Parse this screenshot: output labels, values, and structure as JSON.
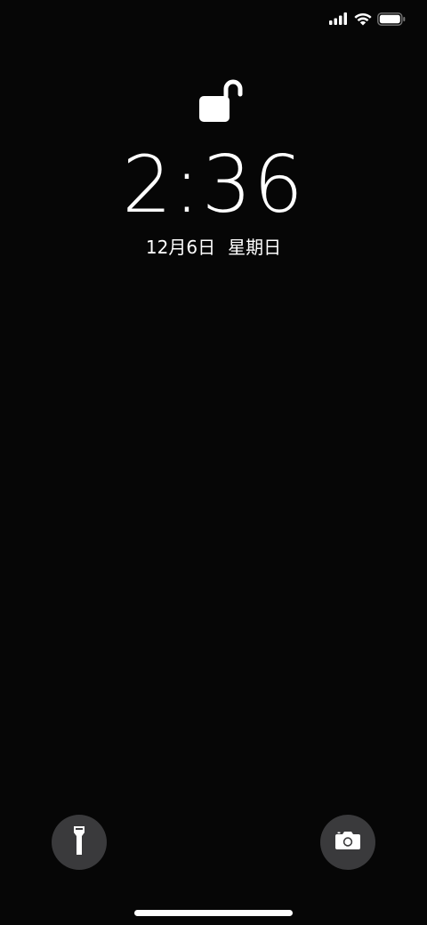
{
  "status_bar": {
    "signal_icon": "cellular-signal-icon",
    "wifi_icon": "wifi-icon",
    "battery_icon": "battery-icon",
    "battery_level": 1.0
  },
  "lock_screen": {
    "lock_icon": "unlocked-padlock-icon",
    "time": "2:36",
    "date": "12月6日",
    "weekday": "星期日"
  },
  "quick_actions": {
    "flashlight_icon": "flashlight-icon",
    "camera_icon": "camera-icon"
  },
  "colors": {
    "background": "#060606",
    "button_background": "#3a3a3c",
    "foreground": "#ffffff"
  }
}
